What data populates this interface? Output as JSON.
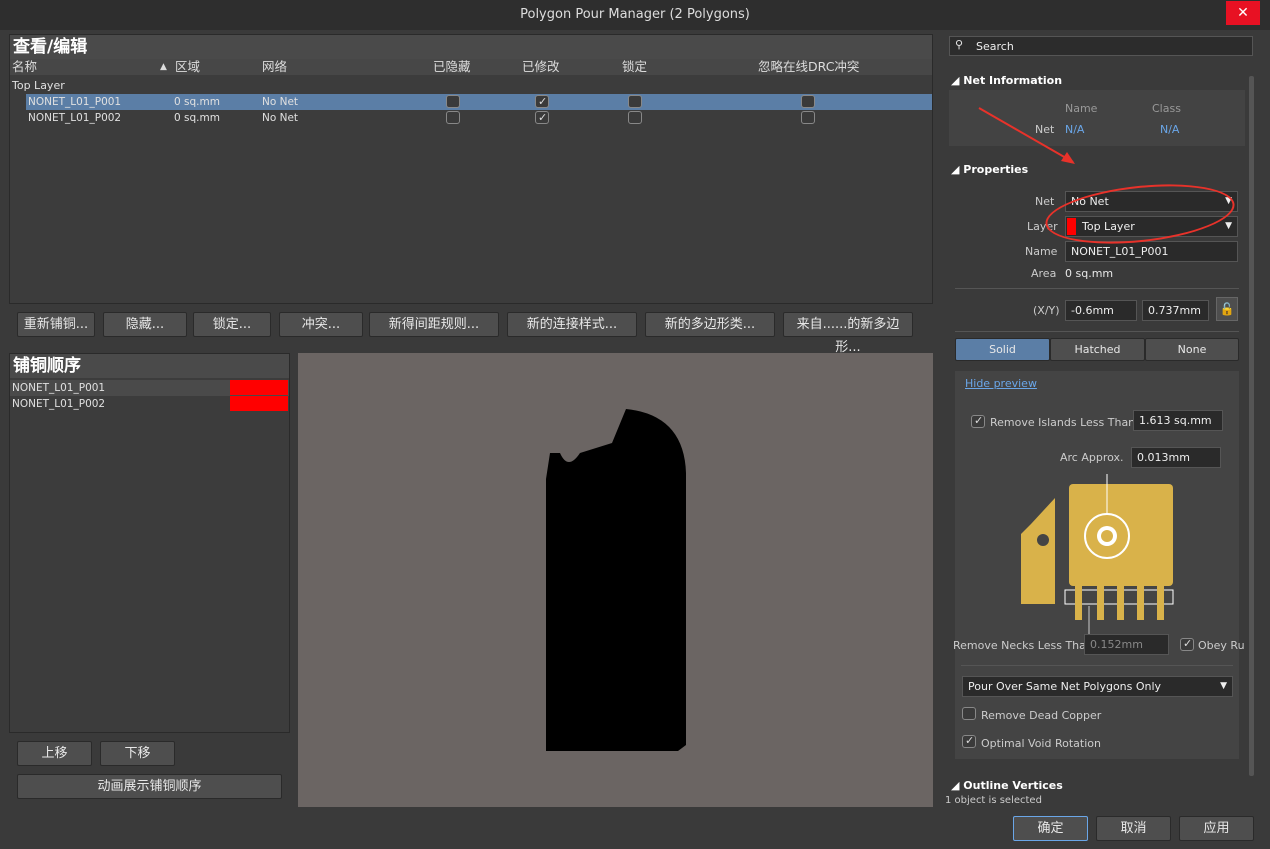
{
  "window": {
    "title": "Polygon Pour Manager (2 Polygons)"
  },
  "view": {
    "title": "查看/编辑",
    "cols": [
      "名称",
      "区域",
      "网络",
      "已隐藏",
      "已修改",
      "锁定",
      "忽略在线DRC冲突"
    ],
    "group": "Top Layer",
    "rows": [
      {
        "name": "NONET_L01_P001",
        "area": "0 sq.mm",
        "net": "No Net"
      },
      {
        "name": "NONET_L01_P002",
        "area": "0 sq.mm",
        "net": "No Net"
      }
    ]
  },
  "actions": [
    "重新铺铜...",
    "隐藏...",
    "锁定...",
    "冲突...",
    "新得间距规则...",
    "新的连接样式...",
    "新的多边形类...",
    "来自......的新多边形..."
  ],
  "order": {
    "title": "铺铜顺序",
    "items": [
      "NONET_L01_P001",
      "NONET_L01_P002"
    ],
    "up": "上移",
    "down": "下移",
    "animate": "动画展示铺铜顺序"
  },
  "right": {
    "search": "Search",
    "net_info": "Net Information",
    "name_h": "Name",
    "class_h": "Class",
    "net_l": "Net",
    "net_name": "N/A",
    "net_class": "N/A",
    "props": "Properties",
    "net": "Net",
    "net_val": "No Net",
    "layer": "Layer",
    "layer_val": "Top Layer",
    "name": "Name",
    "name_val": "NONET_L01_P001",
    "area": "Area",
    "area_val": "0 sq.mm",
    "xy": "(X/Y)",
    "x": "-0.6mm",
    "y": "0.737mm",
    "tabs": [
      "Solid",
      "Hatched",
      "None"
    ],
    "hide_preview": "Hide preview",
    "islands": "Remove Islands Less Than",
    "islands_val": "1.613 sq.mm",
    "arc": "Arc Approx.",
    "arc_val": "0.013mm",
    "necks": "Remove Necks Less Than",
    "necks_val": "0.152mm",
    "obey": "Obey Ru",
    "pour": "Pour Over Same Net Polygons Only",
    "dead": "Remove Dead Copper",
    "void": "Optimal Void Rotation",
    "outline": "Outline Vertices",
    "status": "1 object is selected"
  },
  "footer": {
    "ok": "确定",
    "cancel": "取消",
    "apply": "应用"
  },
  "colors": {
    "accent": "#ff0000",
    "select": "#5b7ea6",
    "copper": "#d9b24a"
  }
}
